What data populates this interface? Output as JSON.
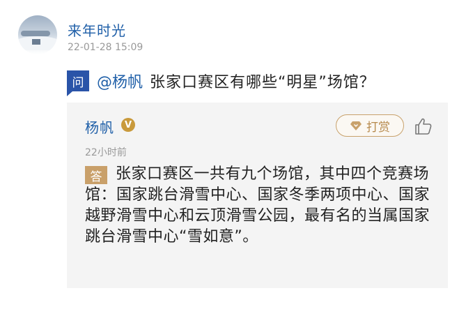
{
  "post": {
    "username": "来年时光",
    "timestamp": "22-01-28 15:09"
  },
  "question": {
    "badge": "问",
    "mention": "@杨帆",
    "text": "张家口赛区有哪些“明星”场馆？"
  },
  "answer": {
    "author": "杨帆",
    "verified_badge": "V",
    "tip_label": "打赏",
    "time": "22小时前",
    "badge": "答",
    "text": "张家口赛区一共有九个场馆，其中四个竞赛场馆：国家跳台滑雪中心、国家冬季两项中心、国家越野滑雪中心和云顶滑雪公园，最有名的当属国家跳台滑雪中心“雪如意”。"
  },
  "colors": {
    "link_blue": "#1f5fa8",
    "question_badge": "#2a54a8",
    "answer_badge": "#c9a06a",
    "card_bg": "#f4f4f4"
  },
  "icons": {
    "avatar": "snow-landscape-avatar",
    "verified": "verified-badge-icon",
    "tip": "diamond-icon",
    "like": "thumbs-up-icon"
  }
}
